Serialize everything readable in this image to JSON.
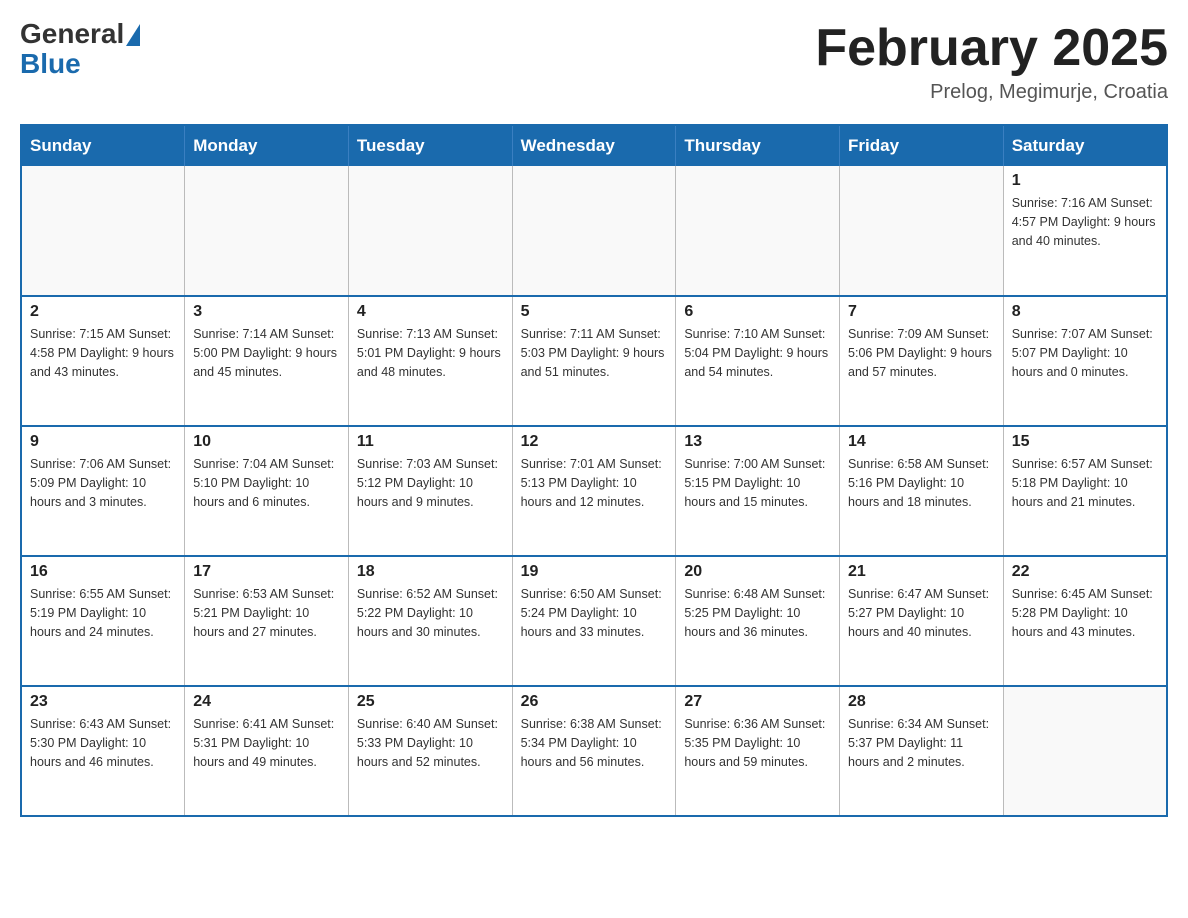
{
  "header": {
    "logo_general": "General",
    "logo_blue": "Blue",
    "month_title": "February 2025",
    "location": "Prelog, Megimurje, Croatia"
  },
  "weekdays": [
    "Sunday",
    "Monday",
    "Tuesday",
    "Wednesday",
    "Thursday",
    "Friday",
    "Saturday"
  ],
  "weeks": [
    [
      {
        "day": "",
        "info": ""
      },
      {
        "day": "",
        "info": ""
      },
      {
        "day": "",
        "info": ""
      },
      {
        "day": "",
        "info": ""
      },
      {
        "day": "",
        "info": ""
      },
      {
        "day": "",
        "info": ""
      },
      {
        "day": "1",
        "info": "Sunrise: 7:16 AM\nSunset: 4:57 PM\nDaylight: 9 hours and 40 minutes."
      }
    ],
    [
      {
        "day": "2",
        "info": "Sunrise: 7:15 AM\nSunset: 4:58 PM\nDaylight: 9 hours and 43 minutes."
      },
      {
        "day": "3",
        "info": "Sunrise: 7:14 AM\nSunset: 5:00 PM\nDaylight: 9 hours and 45 minutes."
      },
      {
        "day": "4",
        "info": "Sunrise: 7:13 AM\nSunset: 5:01 PM\nDaylight: 9 hours and 48 minutes."
      },
      {
        "day": "5",
        "info": "Sunrise: 7:11 AM\nSunset: 5:03 PM\nDaylight: 9 hours and 51 minutes."
      },
      {
        "day": "6",
        "info": "Sunrise: 7:10 AM\nSunset: 5:04 PM\nDaylight: 9 hours and 54 minutes."
      },
      {
        "day": "7",
        "info": "Sunrise: 7:09 AM\nSunset: 5:06 PM\nDaylight: 9 hours and 57 minutes."
      },
      {
        "day": "8",
        "info": "Sunrise: 7:07 AM\nSunset: 5:07 PM\nDaylight: 10 hours and 0 minutes."
      }
    ],
    [
      {
        "day": "9",
        "info": "Sunrise: 7:06 AM\nSunset: 5:09 PM\nDaylight: 10 hours and 3 minutes."
      },
      {
        "day": "10",
        "info": "Sunrise: 7:04 AM\nSunset: 5:10 PM\nDaylight: 10 hours and 6 minutes."
      },
      {
        "day": "11",
        "info": "Sunrise: 7:03 AM\nSunset: 5:12 PM\nDaylight: 10 hours and 9 minutes."
      },
      {
        "day": "12",
        "info": "Sunrise: 7:01 AM\nSunset: 5:13 PM\nDaylight: 10 hours and 12 minutes."
      },
      {
        "day": "13",
        "info": "Sunrise: 7:00 AM\nSunset: 5:15 PM\nDaylight: 10 hours and 15 minutes."
      },
      {
        "day": "14",
        "info": "Sunrise: 6:58 AM\nSunset: 5:16 PM\nDaylight: 10 hours and 18 minutes."
      },
      {
        "day": "15",
        "info": "Sunrise: 6:57 AM\nSunset: 5:18 PM\nDaylight: 10 hours and 21 minutes."
      }
    ],
    [
      {
        "day": "16",
        "info": "Sunrise: 6:55 AM\nSunset: 5:19 PM\nDaylight: 10 hours and 24 minutes."
      },
      {
        "day": "17",
        "info": "Sunrise: 6:53 AM\nSunset: 5:21 PM\nDaylight: 10 hours and 27 minutes."
      },
      {
        "day": "18",
        "info": "Sunrise: 6:52 AM\nSunset: 5:22 PM\nDaylight: 10 hours and 30 minutes."
      },
      {
        "day": "19",
        "info": "Sunrise: 6:50 AM\nSunset: 5:24 PM\nDaylight: 10 hours and 33 minutes."
      },
      {
        "day": "20",
        "info": "Sunrise: 6:48 AM\nSunset: 5:25 PM\nDaylight: 10 hours and 36 minutes."
      },
      {
        "day": "21",
        "info": "Sunrise: 6:47 AM\nSunset: 5:27 PM\nDaylight: 10 hours and 40 minutes."
      },
      {
        "day": "22",
        "info": "Sunrise: 6:45 AM\nSunset: 5:28 PM\nDaylight: 10 hours and 43 minutes."
      }
    ],
    [
      {
        "day": "23",
        "info": "Sunrise: 6:43 AM\nSunset: 5:30 PM\nDaylight: 10 hours and 46 minutes."
      },
      {
        "day": "24",
        "info": "Sunrise: 6:41 AM\nSunset: 5:31 PM\nDaylight: 10 hours and 49 minutes."
      },
      {
        "day": "25",
        "info": "Sunrise: 6:40 AM\nSunset: 5:33 PM\nDaylight: 10 hours and 52 minutes."
      },
      {
        "day": "26",
        "info": "Sunrise: 6:38 AM\nSunset: 5:34 PM\nDaylight: 10 hours and 56 minutes."
      },
      {
        "day": "27",
        "info": "Sunrise: 6:36 AM\nSunset: 5:35 PM\nDaylight: 10 hours and 59 minutes."
      },
      {
        "day": "28",
        "info": "Sunrise: 6:34 AM\nSunset: 5:37 PM\nDaylight: 11 hours and 2 minutes."
      },
      {
        "day": "",
        "info": ""
      }
    ]
  ]
}
